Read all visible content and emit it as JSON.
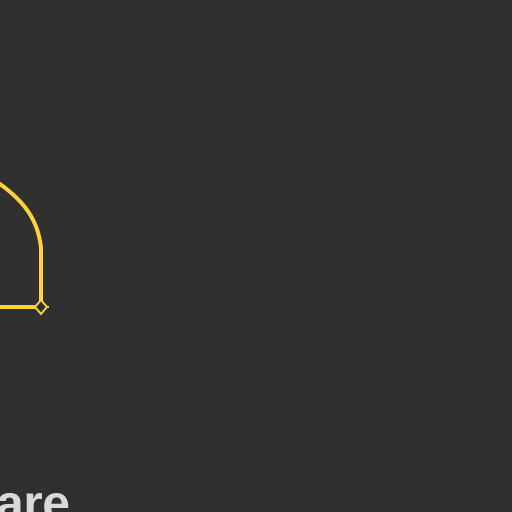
{
  "canvas": {
    "background_color": "#303030"
  },
  "shape": {
    "stroke_color": "#ffd338",
    "type": "rounded-corner-path-with-anchor-handle"
  },
  "anchor_handle": {
    "icon": "diamond-anchor-icon",
    "color": "#ffd338"
  },
  "bottom_text": {
    "text": "are",
    "color": "#d9d9d9"
  }
}
